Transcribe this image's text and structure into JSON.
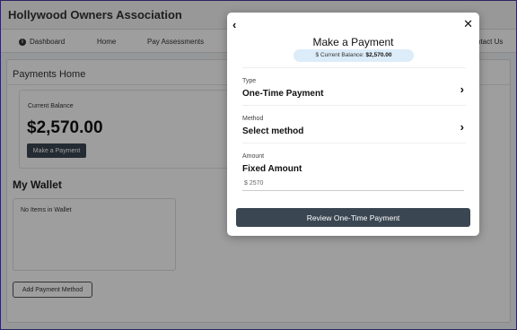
{
  "app": {
    "title": "Hollywood Owners Association"
  },
  "nav": {
    "items": [
      {
        "label": "Dashboard"
      },
      {
        "label": "Home"
      },
      {
        "label": "Pay Assessments"
      },
      {
        "label": "ntact Us"
      }
    ]
  },
  "payments": {
    "section_title": "Payments Home",
    "current_balance_label": "Current Balance",
    "current_balance": "$2,570.00",
    "make_payment_label": "Make a Payment"
  },
  "wallet": {
    "title": "My Wallet",
    "empty_text": "No Items in Wallet",
    "add_method_label": "Add Payment Method"
  },
  "modal": {
    "back_icon": "‹",
    "close_icon": "✕",
    "title": "Make a Payment",
    "balance_prefix": "$ Current Balance:",
    "balance_value": "$2,570.00",
    "type": {
      "label": "Type",
      "value": "One-Time Payment"
    },
    "method": {
      "label": "Method",
      "value": "Select method"
    },
    "amount": {
      "label": "Amount",
      "value": "Fixed Amount",
      "input_value": "$ 2570"
    },
    "review_label": "Review One-Time Payment"
  },
  "colors": {
    "primary_button": "#3a4651",
    "balance_pill": "#dcecf9",
    "frame_border": "#2b2560"
  }
}
